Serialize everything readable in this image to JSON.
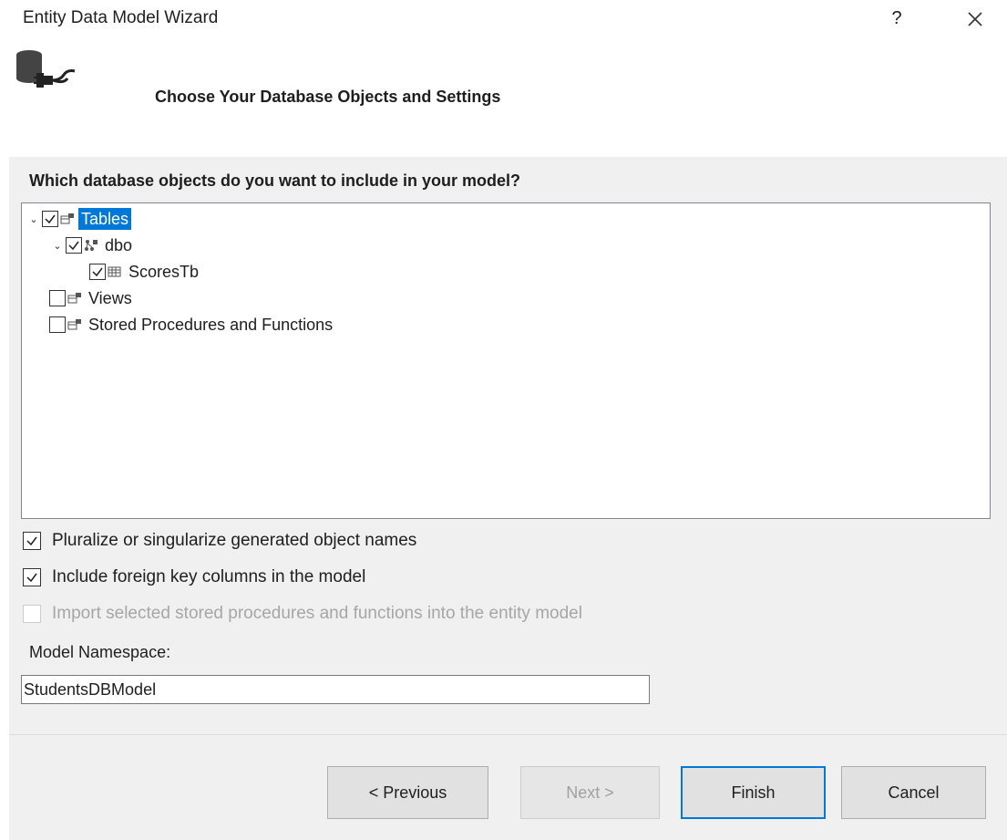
{
  "window": {
    "title": "Entity Data Model Wizard",
    "help_label": "?",
    "close_icon": "close-icon"
  },
  "header": {
    "icon": "database-connection-icon",
    "title": "Choose Your Database Objects and Settings"
  },
  "objects": {
    "question": "Which database objects do you want to include in your model?",
    "tree": [
      {
        "label": "Tables",
        "checked": true,
        "expanded": true,
        "selected": true,
        "icon": "tables-icon"
      },
      {
        "label": "dbo",
        "checked": true,
        "expanded": true,
        "selected": false,
        "icon": "schema-icon"
      },
      {
        "label": "ScoresTb",
        "checked": true,
        "selected": false,
        "icon": "table-icon"
      },
      {
        "label": "Views",
        "checked": false,
        "selected": false,
        "icon": "views-icon"
      },
      {
        "label": "Stored Procedures and Functions",
        "checked": false,
        "selected": false,
        "icon": "procedures-icon"
      }
    ]
  },
  "options": {
    "pluralize": {
      "label": "Pluralize or singularize generated object names",
      "checked": true,
      "enabled": true
    },
    "foreign_keys": {
      "label": "Include foreign key columns in the model",
      "checked": true,
      "enabled": true
    },
    "import_procs": {
      "label": "Import selected stored procedures and functions into the entity model",
      "checked": false,
      "enabled": false
    }
  },
  "namespace": {
    "label": "Model Namespace:",
    "value": "StudentsDBModel"
  },
  "buttons": {
    "previous": "< Previous",
    "next": "Next >",
    "finish": "Finish",
    "cancel": "Cancel"
  },
  "colors": {
    "selection": "#0078d7",
    "panel": "#f0f0f0"
  }
}
